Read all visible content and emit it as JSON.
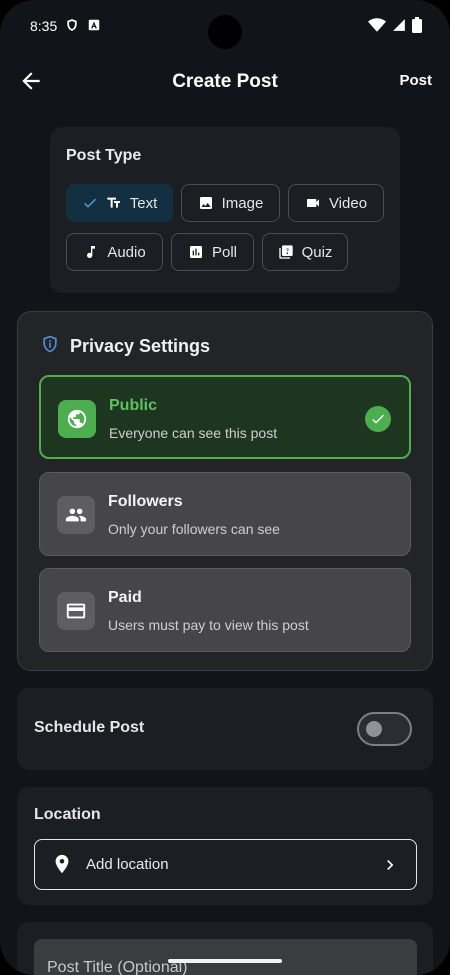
{
  "status_bar": {
    "time": "8:35"
  },
  "app_bar": {
    "title": "Create Post",
    "post_label": "Post"
  },
  "post_type": {
    "heading": "Post Type",
    "options": [
      {
        "label": "Text",
        "icon": "text-format-icon",
        "selected": true
      },
      {
        "label": "Image",
        "icon": "image-icon",
        "selected": false
      },
      {
        "label": "Video",
        "icon": "video-camera-icon",
        "selected": false
      },
      {
        "label": "Audio",
        "icon": "music-note-icon",
        "selected": false
      },
      {
        "label": "Poll",
        "icon": "poll-icon",
        "selected": false
      },
      {
        "label": "Quiz",
        "icon": "quiz-icon",
        "selected": false
      }
    ]
  },
  "privacy": {
    "title": "Privacy Settings",
    "options": [
      {
        "title": "Public",
        "subtitle": "Everyone can see this post",
        "icon": "globe-icon",
        "selected": true
      },
      {
        "title": "Followers",
        "subtitle": "Only your followers can see",
        "icon": "people-icon",
        "selected": false
      },
      {
        "title": "Paid",
        "subtitle": "Users must pay to view this post",
        "icon": "credit-card-icon",
        "selected": false
      }
    ]
  },
  "schedule": {
    "label": "Schedule Post",
    "enabled": false
  },
  "location": {
    "label": "Location",
    "placeholder": "Add location"
  },
  "post_title": {
    "placeholder": "Post Title (Optional)"
  },
  "colors": {
    "background": "#111418",
    "accent_green": "#4cae4f",
    "selected_chip": "#12303f",
    "card": "#1b1f24"
  }
}
